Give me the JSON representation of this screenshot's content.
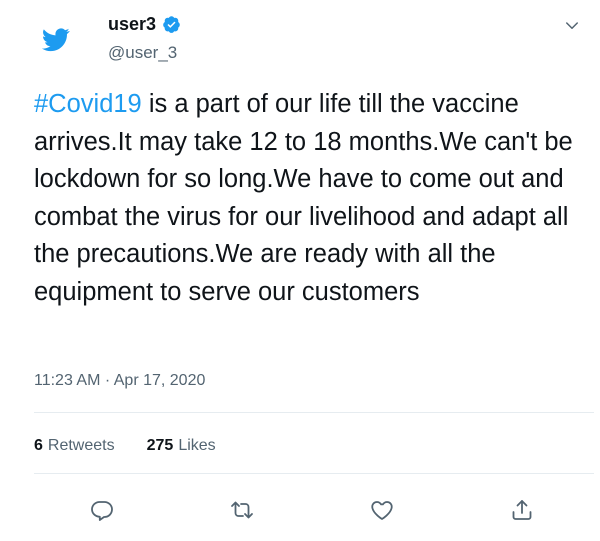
{
  "user": {
    "display_name": "user3",
    "handle": "@user_3",
    "verified": true
  },
  "tweet": {
    "hashtag": "#Covid19",
    "text": " is a part of our life till the vaccine arrives.It  may take 12 to 18 months.We can't be lockdown for so long.We have to come out and combat the virus for our livelihood and adapt all the precautions.We are ready with all the equipment to serve our customers",
    "timestamp": "11:23 AM · Apr 17, 2020"
  },
  "stats": {
    "retweets_count": "6",
    "retweets_label": "Retweets",
    "likes_count": "275",
    "likes_label": "Likes"
  },
  "icons": {
    "logo": "twitter-bird-icon",
    "verified": "verified-badge-icon",
    "menu": "chevron-down-icon",
    "reply": "reply-icon",
    "retweet": "retweet-icon",
    "like": "heart-icon",
    "share": "share-icon"
  },
  "colors": {
    "brand": "#1d9bf0",
    "text": "#0f1419",
    "secondary": "#536471",
    "divider": "#e6ecf0"
  }
}
